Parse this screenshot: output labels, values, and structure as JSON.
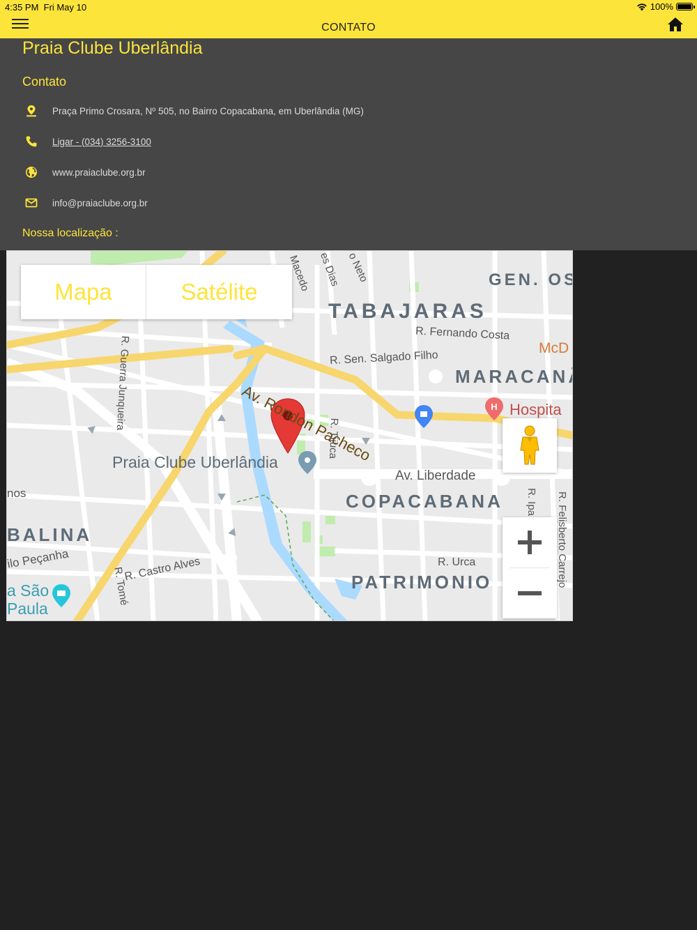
{
  "status": {
    "time": "4:35 PM",
    "date": "Fri May 10",
    "battery": "100%"
  },
  "nav": {
    "title": "CONTATO"
  },
  "club": {
    "name": "Praia Clube Uberlândia"
  },
  "contact": {
    "heading": "Contato",
    "address": "Praça Primo Crosara, Nº 505, no Bairro Copacabana, em Uberlândia (MG)",
    "phone": "Ligar - (034) 3256-3100",
    "website": "www.praiaclube.org.br",
    "email": "info@praiaclube.org.br"
  },
  "location": {
    "heading": "Nossa localização :",
    "map_types": {
      "map": "Mapa",
      "satellite": "Satélite"
    },
    "labels": {
      "tabajaras": "TABAJARAS",
      "gen": "GEN. OS",
      "maracana": "MARACANÃ",
      "copacabana": "COPACABANA",
      "patrimonio": "PATRIMONIO",
      "balina": "BALINA",
      "fernando_costa": "R. Fernando Costa",
      "salgado_filho": "R. Sen. Salgado Filho",
      "rondon": "Av. Rondon Pacheco",
      "guerra_junqueira": "R. Guerra Junqueira",
      "tijuca": "R. Tijuca",
      "liberdade": "Av. Liberdade",
      "castro_alves": "R. Castro Alves",
      "urca": "R. Urca",
      "felisberto": "R. Felisberto Carrejo",
      "ipa": "R. Ipa",
      "peganha": "ilo Peçanha",
      "tome": "R. Tomé",
      "sao_paulo_1": "a São",
      "sao_paulo_2": "Paula",
      "nos": "nos",
      "hospital": "Hospita",
      "mcd": "McD",
      "macedo": "Macedo",
      "dias": "es Dias",
      "neto": "o Neto",
      "place": "Praia Clube Uberlândia"
    },
    "colors": {
      "marker": "#e53935",
      "road_major": "#f8d66e",
      "water": "#aadaff",
      "park": "#c0ecae"
    }
  }
}
